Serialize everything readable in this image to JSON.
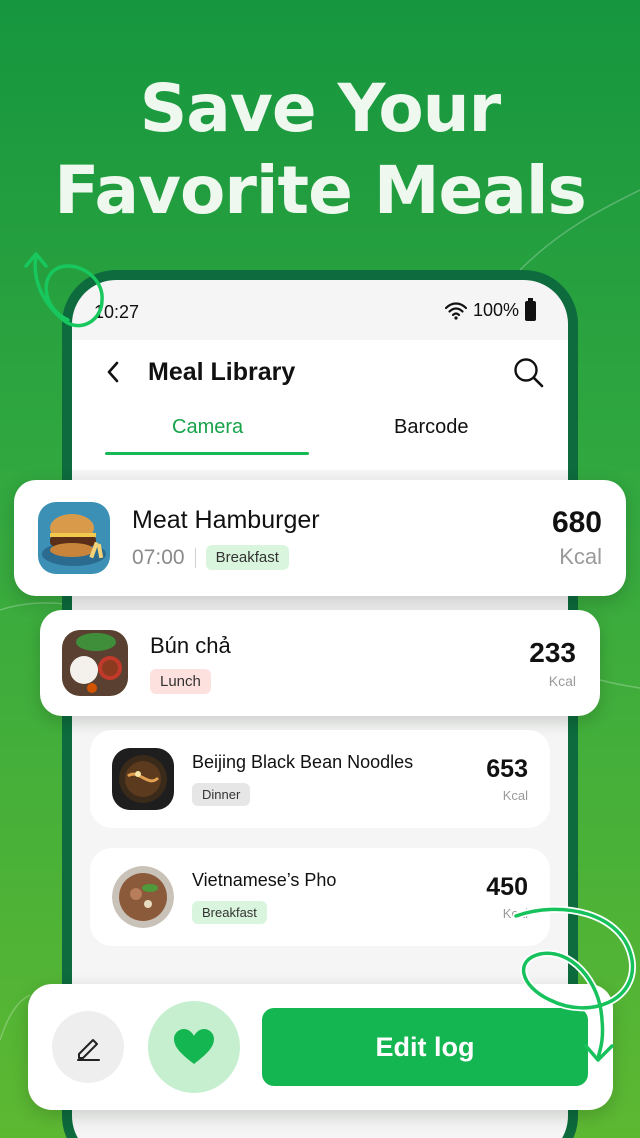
{
  "promo": {
    "headline_line1": "Save Your",
    "headline_line2": "Favorite Meals"
  },
  "status_bar": {
    "time": "10:27",
    "battery": "100%"
  },
  "header": {
    "title": "Meal Library",
    "tabs": [
      {
        "label": "Camera",
        "active": true
      },
      {
        "label": "Barcode",
        "active": false
      }
    ]
  },
  "meals": [
    {
      "name": "Meat Hamburger",
      "time": "07:00",
      "tag": "Breakfast",
      "kcal": "680",
      "unit": "Kcal",
      "icon": "hamburger-icon"
    },
    {
      "name": "Bún chả",
      "time": "",
      "tag": "Lunch",
      "kcal": "233",
      "unit": "Kcal",
      "icon": "bun-cha-icon"
    },
    {
      "name": "Beijing Black Bean Noodles",
      "time": "",
      "tag": "Dinner",
      "kcal": "653",
      "unit": "Kcal",
      "icon": "noodles-icon"
    },
    {
      "name": "Vietnamese’s Pho",
      "time": "",
      "tag": "Breakfast",
      "kcal": "450",
      "unit": "Kcal",
      "icon": "pho-icon"
    }
  ],
  "actions": {
    "edit_log_label": "Edit log"
  },
  "colors": {
    "brand_green": "#14b652",
    "phone_frame": "#0d6b3d",
    "tag_breakfast": "#d9f5dd",
    "tag_lunch": "#fde1de",
    "tag_dinner": "#e6e6e6"
  }
}
